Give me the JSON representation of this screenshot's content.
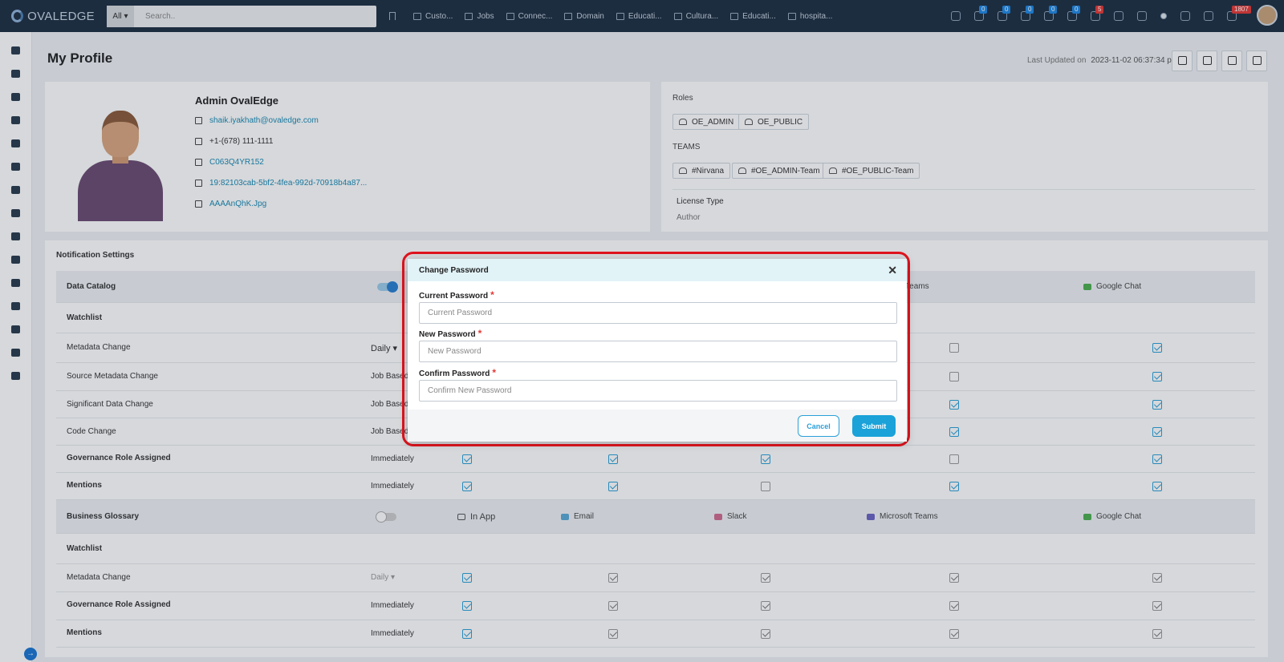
{
  "app": {
    "logo_text": "OVALEDGE"
  },
  "topbar": {
    "search_scope": "All",
    "search_placeholder": "Search..",
    "nav": [
      "Custo...",
      "Jobs",
      "Connec...",
      "Domain",
      "Educati...",
      "Cultura...",
      "Educati...",
      "hospita..."
    ],
    "badges": [
      "0",
      "0",
      "0",
      "0",
      "0",
      "5",
      "1807"
    ]
  },
  "page": {
    "title": "My Profile",
    "last_updated_label": "Last Updated on",
    "last_updated_value": "2023-11-02 06:37:34 pm"
  },
  "profile": {
    "name": "Admin OvalEdge",
    "email": "shaik.iyakhath@ovaledge.com",
    "phone": "+1-(678) 111-1111",
    "slack_id": "C063Q4YR152",
    "teams_id": "19:82103cab-5bf2-4fea-992d-70918b4a87...",
    "gchat_id": "AAAAnQhK.Jpg"
  },
  "roles": {
    "label": "Roles",
    "items": [
      "OE_ADMIN",
      "OE_PUBLIC"
    ],
    "teams_label": "TEAMS",
    "teams": [
      "#Nirvana",
      "#OE_ADMIN-Team",
      "#OE_PUBLIC-Team"
    ],
    "license_label": "License Type",
    "license_value": "Author"
  },
  "notifications": {
    "title": "Notification Settings",
    "sections": [
      {
        "name": "Data Catalog",
        "enabled": true
      },
      {
        "name": "Business Glossary",
        "enabled": false
      }
    ],
    "channels": [
      "In App",
      "Email",
      "Slack",
      "Microsoft Teams",
      "Google Chat"
    ],
    "partial_channel_label": "ft Teams",
    "rows": {
      "watchlist": "Watchlist",
      "metadata_change": "Metadata Change",
      "source_metadata_change": "Source Metadata Change",
      "significant_data_change": "Significant Data Change",
      "code_change": "Code Change",
      "governance_role": "Governance Role Assigned",
      "mentions": "Mentions"
    },
    "freq": {
      "daily": "Daily",
      "job_based": "Job Based",
      "immediately": "Immediately"
    }
  },
  "modal": {
    "title": "Change Password",
    "close_icon": "close-icon",
    "current_label": "Current Password",
    "current_placeholder": "Current Password",
    "new_label": "New Password",
    "new_placeholder": "New Password",
    "confirm_label": "Confirm Password",
    "confirm_placeholder": "Confirm New Password",
    "required_mark": "*",
    "cancel": "Cancel",
    "submit": "Submit"
  },
  "colors": {
    "accent": "#1aa2d9",
    "topbar": "#1e2f42",
    "highlight": "#e0141e"
  }
}
